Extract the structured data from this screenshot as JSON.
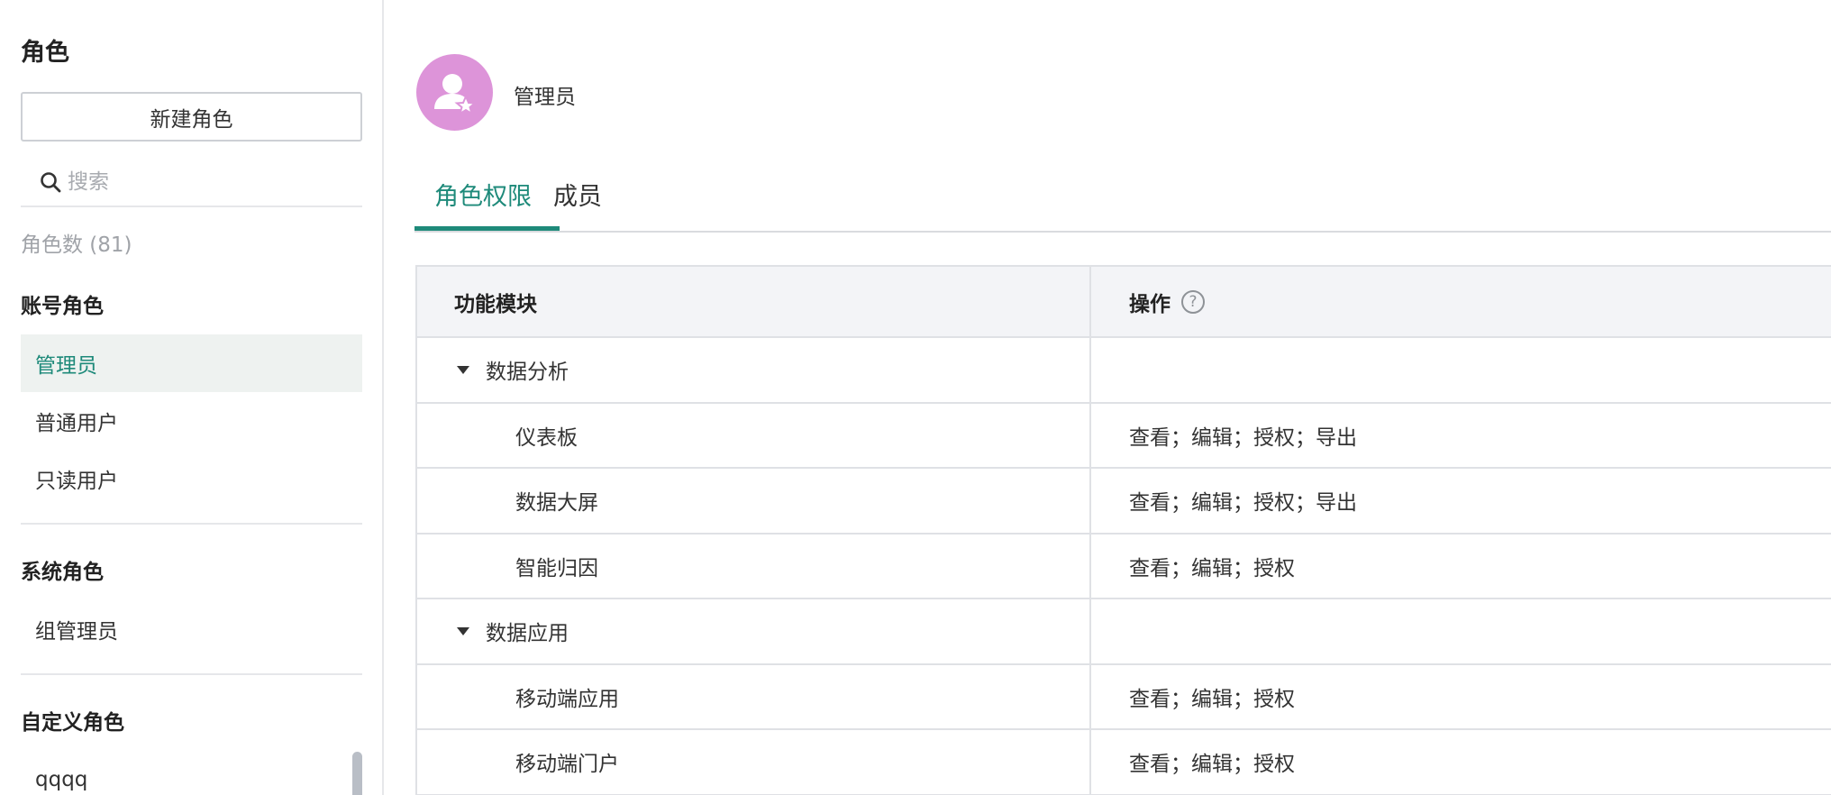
{
  "sidebar": {
    "title": "角色",
    "new_role_label": "新建角色",
    "search_placeholder": "搜索",
    "role_count": "角色数 (81)",
    "groups": [
      {
        "title": "账号角色",
        "items": [
          "管理员",
          "普通用户",
          "只读用户"
        ]
      },
      {
        "title": "系统角色",
        "items": [
          "组管理员"
        ]
      },
      {
        "title": "自定义角色",
        "items": [
          "qqqq"
        ]
      }
    ],
    "active_item": "管理员"
  },
  "main": {
    "role_name": "管理员",
    "tabs": [
      {
        "label": "角色权限",
        "active": true
      },
      {
        "label": "成员",
        "active": false
      }
    ],
    "table": {
      "headers": [
        "功能模块",
        "操作"
      ],
      "rows": [
        {
          "module": "数据分析",
          "ops": "",
          "type": "group"
        },
        {
          "module": "仪表板",
          "ops": "查看；编辑；授权；导出",
          "type": "child"
        },
        {
          "module": "数据大屏",
          "ops": "查看；编辑；授权；导出",
          "type": "child"
        },
        {
          "module": "智能归因",
          "ops": "查看；编辑；授权",
          "type": "child"
        },
        {
          "module": "数据应用",
          "ops": "",
          "type": "group"
        },
        {
          "module": "移动端应用",
          "ops": "查看；编辑；授权",
          "type": "child"
        },
        {
          "module": "移动端门户",
          "ops": "查看；编辑；授权",
          "type": "child"
        }
      ]
    }
  },
  "colors": {
    "accent": "#1e8a7a",
    "avatar_bg": "#dd94d9",
    "active_item_bg": "#eef2f0",
    "table_header_bg": "#f3f4f7"
  },
  "icons": {
    "search": "search-icon",
    "avatar": "user-star-icon",
    "help": "help-circle-icon",
    "expand": "caret-down-icon"
  }
}
